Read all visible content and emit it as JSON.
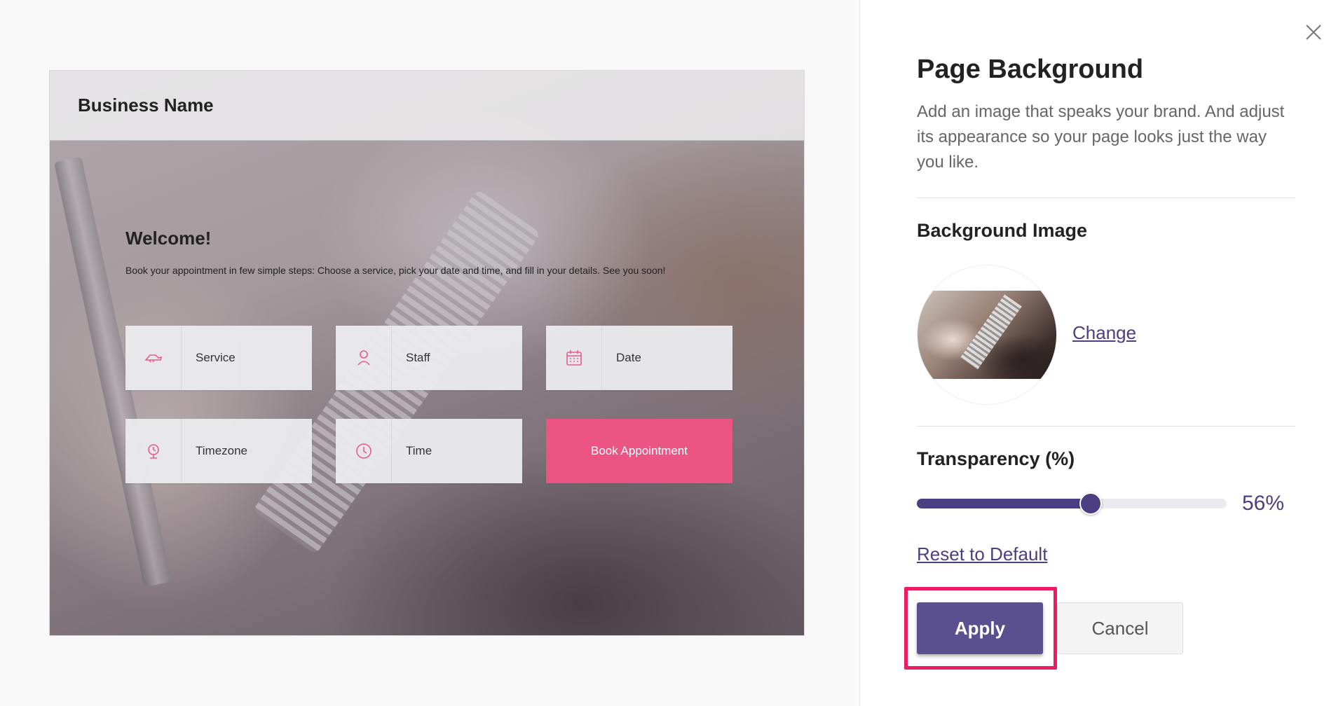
{
  "preview": {
    "business_name": "Business Name",
    "welcome_title": "Welcome!",
    "intro_text": "Book your appointment in few simple steps: Choose a service, pick your date and time, and fill in your details. See you soon!",
    "tiles": [
      {
        "label": "Service",
        "icon": "service-icon"
      },
      {
        "label": "Staff",
        "icon": "staff-icon"
      },
      {
        "label": "Date",
        "icon": "calendar-icon"
      },
      {
        "label": "Timezone",
        "icon": "globe-icon"
      },
      {
        "label": "Time",
        "icon": "clock-icon"
      }
    ],
    "book_button_label": "Book Appointment",
    "accent_color": "#ec5483"
  },
  "panel": {
    "title": "Page Background",
    "description": "Add an image that speaks your brand. And adjust its appearance so your page looks just the way you like.",
    "background_image_label": "Background Image",
    "change_link": "Change",
    "transparency_label": "Transparency (%)",
    "transparency_value": 56,
    "transparency_display": "56%",
    "reset_link": "Reset to Default",
    "apply_label": "Apply",
    "cancel_label": "Cancel",
    "primary_color": "#4b3e82",
    "highlight_color": "#ec1c63"
  }
}
